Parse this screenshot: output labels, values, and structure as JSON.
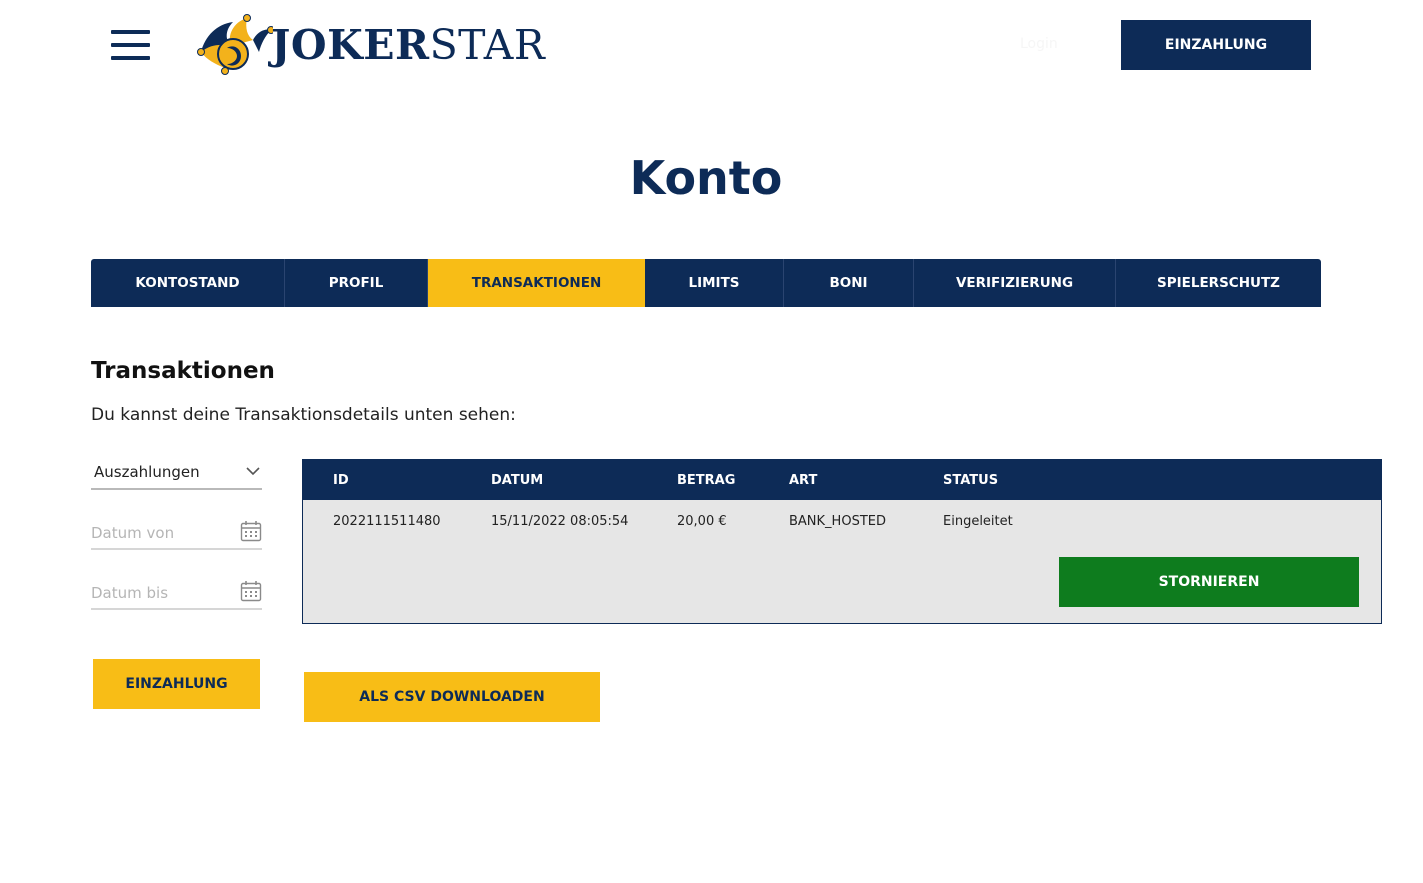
{
  "header": {
    "logo_part1": "JOKER",
    "logo_part2": "STAR",
    "login_hint": "Login",
    "deposit_label": "EINZAHLUNG",
    "menu_icon": "hamburger-menu-icon",
    "logo_icon": "jester-hat-icon"
  },
  "page": {
    "title": "Konto"
  },
  "tabs": [
    {
      "label": "KONTOSTAND",
      "active": false
    },
    {
      "label": "PROFIL",
      "active": false
    },
    {
      "label": "TRANSAKTIONEN",
      "active": true
    },
    {
      "label": "LIMITS",
      "active": false
    },
    {
      "label": "BONI",
      "active": false
    },
    {
      "label": "VERIFIZIERUNG",
      "active": false
    },
    {
      "label": "SPIELERSCHUTZ",
      "active": false
    }
  ],
  "section": {
    "title": "Transaktionen",
    "subtitle": "Du kannst deine Transaktionsdetails unten sehen:"
  },
  "filters": {
    "type_selected": "Auszahlungen",
    "date_from_placeholder": "Datum von",
    "date_to_placeholder": "Datum bis",
    "calendar_icon": "calendar-icon",
    "chevron_icon": "chevron-down-icon"
  },
  "table": {
    "columns": [
      "ID",
      "DATUM",
      "BETRAG",
      "ART",
      "STATUS"
    ],
    "rows": [
      {
        "id": "2022111511480",
        "datum": "15/11/2022 08:05:54",
        "betrag": "20,00 €",
        "art": "BANK_HOSTED",
        "status": "Eingeleitet",
        "action_label": "STORNIEREN"
      }
    ]
  },
  "actions": {
    "deposit_label": "EINZAHLUNG",
    "csv_label": "ALS CSV DOWNLOADEN"
  },
  "colors": {
    "navy": "#0d2b57",
    "yellow": "#f8bd16",
    "green": "#0e7c1e",
    "table_bg": "#e6e6e6"
  }
}
